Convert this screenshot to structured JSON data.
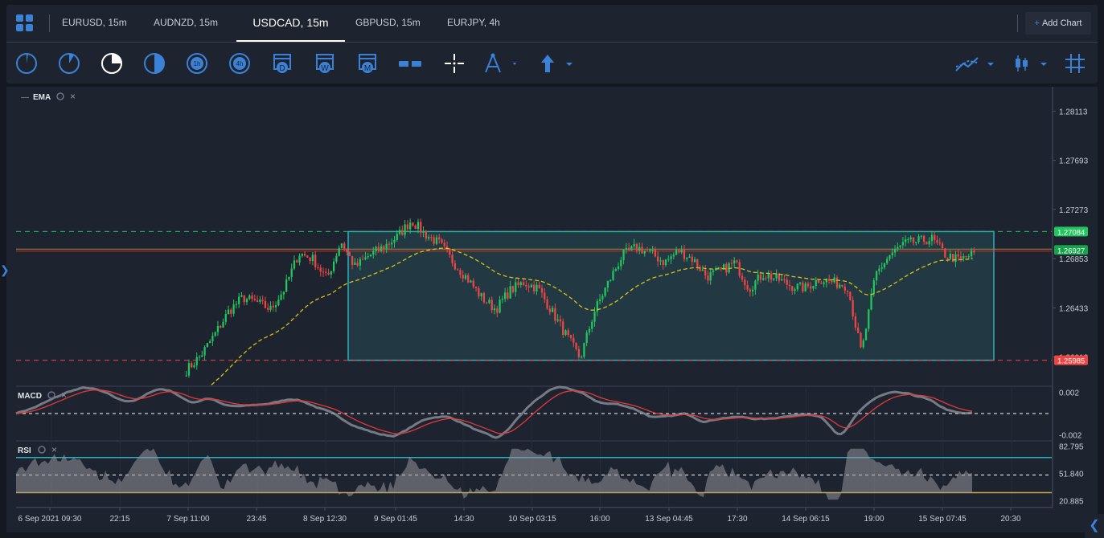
{
  "tabs": [
    {
      "label": "EURUSD, 15m",
      "active": false
    },
    {
      "label": "AUDNZD, 15m",
      "active": false
    },
    {
      "label": "USDCAD, 15m",
      "active": true
    },
    {
      "label": "GBPUSD, 15m",
      "active": false
    },
    {
      "label": "EURJPY, 4h",
      "active": false
    }
  ],
  "add_chart_label": "Add Chart",
  "toolbar": {
    "timeframes": [
      "1m",
      "5m",
      "15m",
      "30m",
      "1h",
      "4h",
      "D",
      "W",
      "M"
    ],
    "tools": [
      "range-tool-icon",
      "crosshair-icon",
      "draw-tools-icon",
      "arrow-up-icon"
    ],
    "right_tools": [
      "chart-line-type-icon",
      "candlestick-icon",
      "grid-icon"
    ],
    "accent": "#3b82d6"
  },
  "chart_data": [
    {
      "type": "candlestick",
      "symbol": "USDCAD",
      "timeframe": "15m",
      "indicator_label": "EMA",
      "y_ticks": [
        "1.28113",
        "1.27693",
        "1.27273",
        "1.26853",
        "1.26433",
        "1.26013"
      ],
      "ylim": [
        1.2577,
        1.2828
      ],
      "price_labels": [
        {
          "value": "1.27084",
          "color": "#22c55e"
        },
        {
          "value": "1.26927",
          "color": "#16a34a"
        },
        {
          "value": "1.25985",
          "color": "#ef4444"
        }
      ],
      "levels": {
        "green_dashed": 1.27084,
        "red_dashed": 1.25985,
        "last": 1.26927
      },
      "box": {
        "top": 1.27084,
        "bottom": 1.25985
      },
      "x_labels": [
        "6 Sep 2021 09:30",
        "22:15",
        "7 Sep 11:00",
        "23:45",
        "8 Sep 12:30",
        "9 Sep 01:45",
        "14:30",
        "10 Sep 03:15",
        "16:00",
        "13 Sep 04:45",
        "17:30",
        "14 Sep 06:15",
        "19:00",
        "15 Sep 07:45",
        "20:30"
      ],
      "close_anchors": [
        1.259,
        1.2602,
        1.262,
        1.264,
        1.2652,
        1.2648,
        1.2642,
        1.266,
        1.269,
        1.2685,
        1.2668,
        1.27,
        1.2678,
        1.2688,
        1.2695,
        1.2704,
        1.2718,
        1.2706,
        1.2698,
        1.2682,
        1.2668,
        1.2652,
        1.2642,
        1.2658,
        1.2665,
        1.266,
        1.264,
        1.262,
        1.26,
        1.264,
        1.2665,
        1.2688,
        1.2695,
        1.269,
        1.2682,
        1.2692,
        1.2685,
        1.267,
        1.2675,
        1.2682,
        1.266,
        1.2672,
        1.2668,
        1.2662,
        1.266,
        1.2668,
        1.2665,
        1.2662,
        1.2604,
        1.2672,
        1.2688,
        1.2698,
        1.27,
        1.2702,
        1.2688,
        1.2684,
        1.269
      ]
    },
    {
      "type": "line",
      "indicator_label": "MACD",
      "y_ticks": [
        "0.002",
        "-0.002"
      ],
      "ylim": [
        -0.0025,
        0.0025
      ]
    },
    {
      "type": "area",
      "indicator_label": "RSI",
      "y_ticks": [
        "82.795",
        "51.840",
        "20.885"
      ],
      "ylim": [
        15,
        88
      ],
      "levels": [
        70,
        30
      ]
    }
  ]
}
